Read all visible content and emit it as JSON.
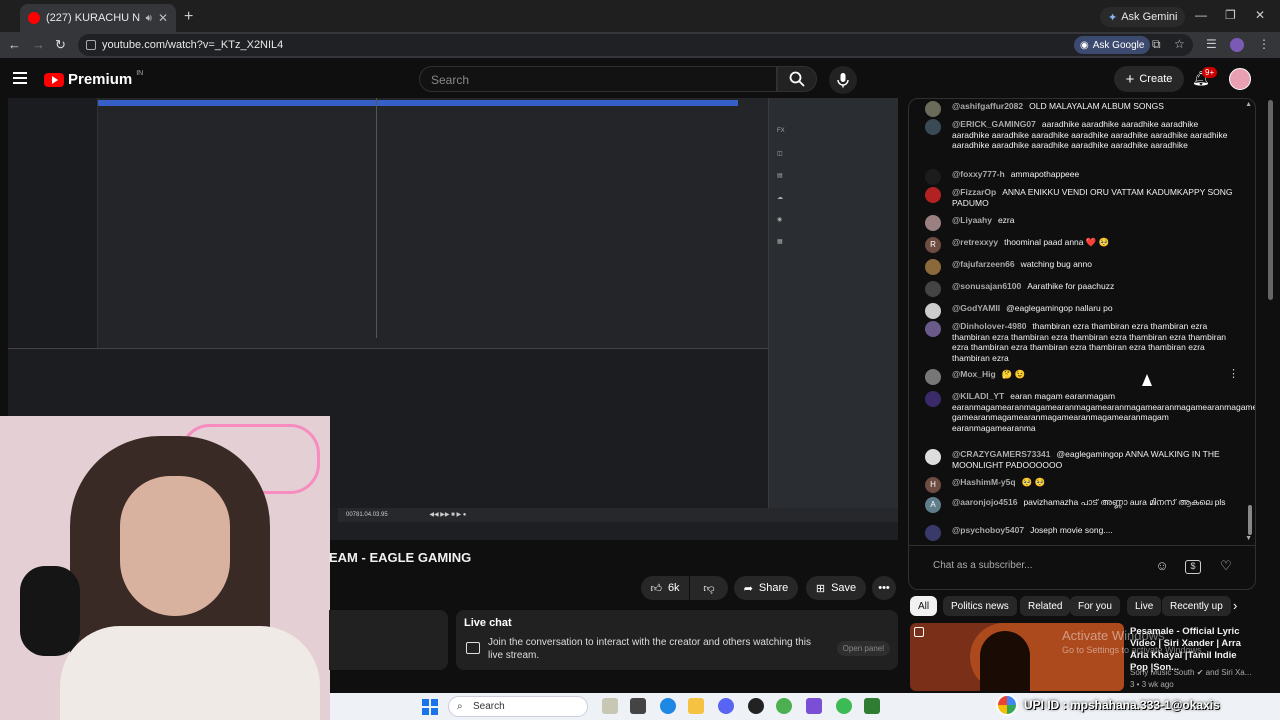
{
  "browser": {
    "tab_title": "(227) KURACHU NERAM SA",
    "ask_gemini": "Ask Gemini",
    "url": "youtube.com/watch?v=_KTz_X2NIL4",
    "ask_google": "Ask Google"
  },
  "header": {
    "logo_text": "Premium",
    "country": "IN",
    "search_placeholder": "Search",
    "create_label": "Create",
    "notif_count": "9+"
  },
  "video": {
    "title": "EAM - EAGLE GAMING",
    "transport_time": "00781.04.03.95",
    "likes": "6k",
    "share_label": "Share",
    "save_label": "Save"
  },
  "live_chat_card": {
    "title": "Live chat",
    "text": "Join the conversation to interact with the creator and others watching this live stream.",
    "open_panel": "Open panel"
  },
  "chat": {
    "messages": [
      {
        "author": "@ashifgaffur2082",
        "text": "OLD MALAYALAM ALBUM SONGS",
        "avatar_color": "#6b6b5a",
        "initial": ""
      },
      {
        "author": "@ERICK_GAMING07",
        "text": "aaradhike aaradhike aaradhike aaradhike aaradhike aaradhike aaradhike aaradhike aaradhike aaradhike aaradhike aaradhike aaradhike aaradhike aaradhike aaradhike aaradhike",
        "avatar_color": "#3a4a55",
        "initial": ""
      },
      {
        "author": "@foxxy777-h",
        "text": "ammapothappeee",
        "avatar_color": "#1c1c1c",
        "initial": ""
      },
      {
        "author": "@FizzarOp",
        "text": "ANNA ENIKKU VENDI ORU VATTAM KADUMKAPPY SONG PADUMO",
        "avatar_color": "#b22222",
        "initial": ""
      },
      {
        "author": "@Liyaahy",
        "text": "ezra",
        "avatar_color": "#9a8080",
        "initial": ""
      },
      {
        "author": "@retrexxyy",
        "text": "thoominal paad anna ❤️ 🥺",
        "avatar_color": "#6d4c41",
        "initial": "R"
      },
      {
        "author": "@fajufarzeen66",
        "text": "watching bug anno",
        "avatar_color": "#8a6a3a",
        "initial": ""
      },
      {
        "author": "@sonusajan6100",
        "text": "Aarathike for paachuzz",
        "avatar_color": "#444",
        "initial": ""
      },
      {
        "author": "@GodYAMII",
        "text": "@eaglegamingop nallaru po",
        "avatar_color": "#ccc",
        "initial": ""
      },
      {
        "author": "@Dinholover-4980",
        "text": "thambiran ezra thambiran ezra thambiran ezra thambiran ezra thambiran ezra thambiran ezra thambiran ezra thambiran ezra thambiran ezra thambiran ezra thambiran ezra thambiran ezra thambiran ezra",
        "avatar_color": "#6a5a8a",
        "initial": ""
      },
      {
        "author": "@Mox_Hig",
        "text": "🤔 😉",
        "avatar_color": "#777",
        "initial": ""
      },
      {
        "author": "@KILADI_YT",
        "text": "earan magam earanmagam earanmagamearanmagamearanmagamearanmagamearanmagamearanmagamearanmagamearanmagamearanmagamearanma gamearanmagamearanmagamearanmagamearanmagam earanmagamearanma",
        "avatar_color": "#3a2a6a",
        "initial": ""
      },
      {
        "author": "@CRAZYGAMERS73341",
        "text": "@eaglegamingop ANNA WALKING IN THE MOONLIGHT PADOOOOOO",
        "avatar_color": "#ddd",
        "initial": ""
      },
      {
        "author": "@HashimM-y5q",
        "text": "🥺 🥺",
        "avatar_color": "#6d4c41",
        "initial": "H"
      },
      {
        "author": "@aaronjojo4516",
        "text": "pavizhamazha പാട് അണ്ണാ aura മിനസ് ആകലെ pls",
        "avatar_color": "#607d8b",
        "initial": "A"
      },
      {
        "author": "@psychoboy5407",
        "text": "Joseph movie song....",
        "avatar_color": "#3a3a6a",
        "initial": ""
      }
    ],
    "input_placeholder": "Chat as a subscriber..."
  },
  "chips": [
    "All",
    "Politics news",
    "Related",
    "For you",
    "Live",
    "Recently up"
  ],
  "recommendation": {
    "title": "Pesamale - Official Lyric Video | Siri Xander | Arra Aria Khayal |Tamil Indie Pop |Son...",
    "channel": "Sony Music South ✔ and Siri Xa...",
    "meta": "3 • 3 wk ago"
  },
  "watermark": {
    "line1": "Activate Windows",
    "line2": "Go to Settings to activate Windows."
  },
  "taskbar": {
    "search": "Search"
  },
  "overlay": {
    "upi": "UPI ID : mpshahana.333-1@okaxis"
  }
}
